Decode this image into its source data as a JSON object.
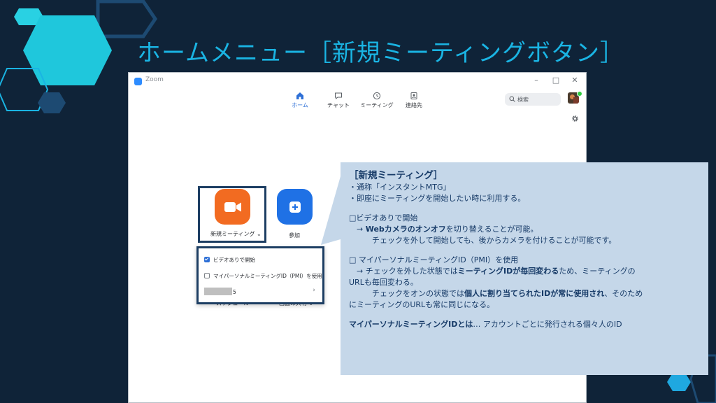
{
  "slide": {
    "title": "ホームメニュー［新規ミーティングボタン］"
  },
  "zoom": {
    "window_title": "Zoom",
    "window_controls": {
      "minimize": "–",
      "maximize": "□",
      "close": "✕"
    },
    "nav": [
      {
        "label": "ホーム",
        "icon": "home-icon",
        "active": true
      },
      {
        "label": "チャット",
        "icon": "chat-icon"
      },
      {
        "label": "ミーティング",
        "icon": "clock-icon"
      },
      {
        "label": "連絡先",
        "icon": "contacts-icon"
      }
    ],
    "search_placeholder": "検索",
    "new_meeting_label": "新規ミーティング ⌄",
    "join_label": "参加",
    "dropdown": {
      "video_on_label": "ビデオありで開始",
      "video_on_checked": true,
      "pmi_label": "マイパーソナルミーティングID（PMI）を使用",
      "pmi_checked": false,
      "pmi_suffix": "5",
      "chevron": "›"
    },
    "peek_schedule": "スケジュール",
    "peek_share": "画面の共有 ⌄"
  },
  "callout": {
    "title": "［新規ミーティング］",
    "line1": "・通称「インスタントMTG」",
    "line2": "・即座にミーティングを開始したい時に利用する。",
    "sec1_head": "□ビデオありで開始",
    "sec1_a_pre": "　→ ",
    "sec1_a_bold": "Webカメラのオンオフ",
    "sec1_a_post": "を切り替えることが可能。",
    "sec1_b": "　　　チェックを外して開始しても、後からカメラを付けることが可能です。",
    "sec2_head": "□ マイパーソナルミーティングID（PMI）を使用",
    "sec2_a_pre": "　→ チェックを外した状態では",
    "sec2_a_bold": "ミーティングIDが毎回変わる",
    "sec2_a_post": "ため、ミーティングの",
    "sec2_b": "URLも毎回変わる。",
    "sec2_c_pre": "　　　チェックをオンの状態では",
    "sec2_c_bold": "個人に割り当てられたIDが常に使用され",
    "sec2_c_post": "、そのため",
    "sec2_d": "にミーティングのURLも常に同じになる。",
    "def_bold": "マイパーソナルミーティングIDとは",
    "def_post": "… アカウントごとに発行される個々人のID"
  },
  "colors": {
    "background": "#0f2338",
    "title": "#1ab4e3",
    "callout_bg": "#c5d7e9",
    "callout_text": "#163a67",
    "new_meeting_orange": "#f26b21",
    "join_blue": "#1f71e5",
    "highlight_border": "#1d3e63"
  }
}
